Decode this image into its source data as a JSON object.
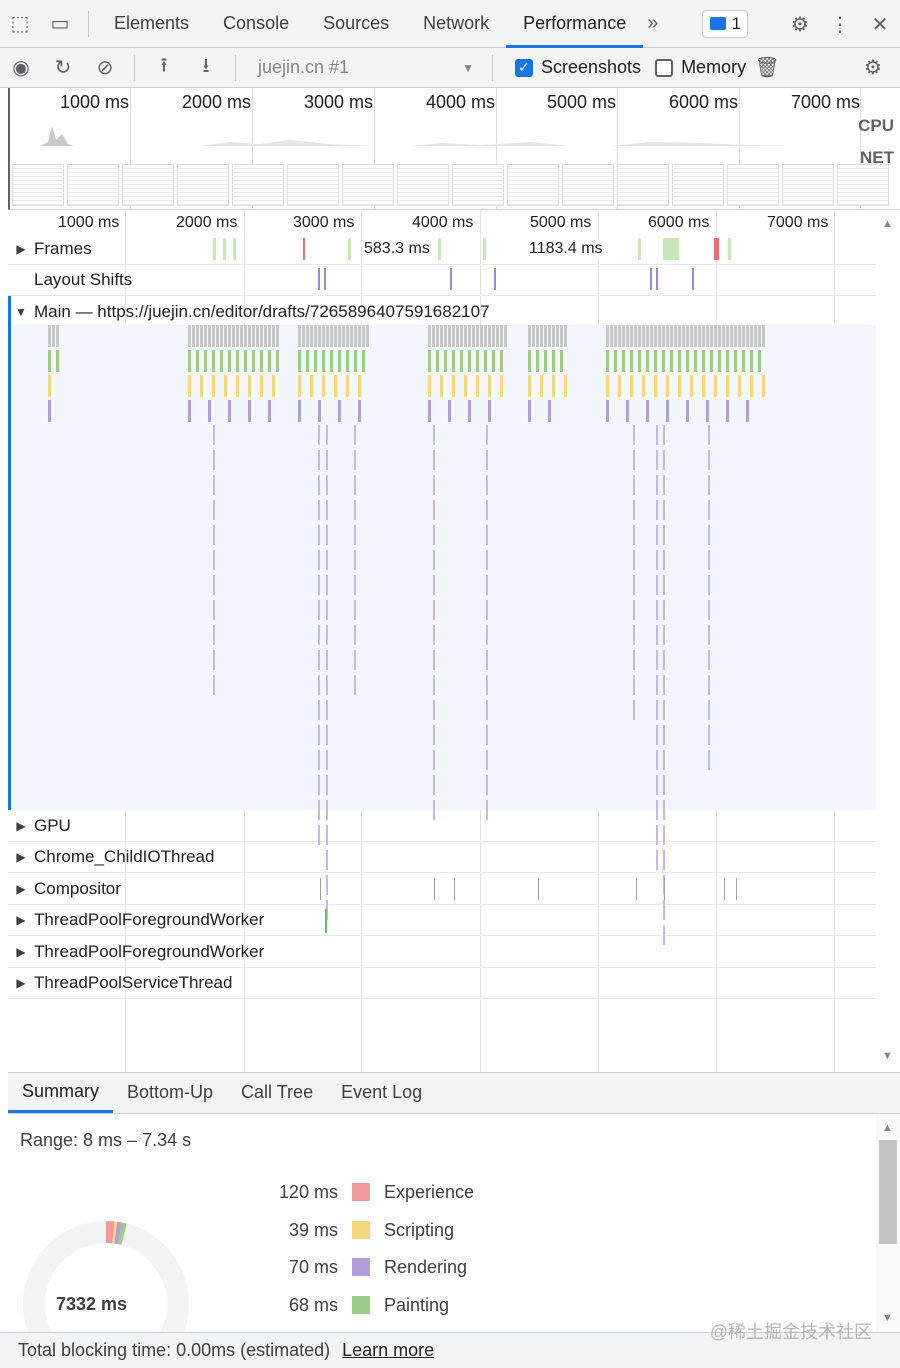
{
  "devtools": {
    "tabs": [
      {
        "label": "Elements"
      },
      {
        "label": "Console"
      },
      {
        "label": "Sources"
      },
      {
        "label": "Network"
      },
      {
        "label": "Performance"
      }
    ],
    "active_tab": "Performance",
    "issues_count": "1"
  },
  "toolbar": {
    "recording": "juejin.cn #1",
    "screenshots_label": "Screenshots",
    "screenshots_checked": true,
    "memory_label": "Memory",
    "memory_checked": false
  },
  "overview": {
    "ruler": [
      "1000 ms",
      "2000 ms",
      "3000 ms",
      "4000 ms",
      "5000 ms",
      "6000 ms",
      "7000 ms"
    ],
    "cpu_label": "CPU",
    "net_label": "NET"
  },
  "flame": {
    "ruler": [
      "1000 ms",
      "2000 ms",
      "3000 ms",
      "4000 ms",
      "5000 ms",
      "6000 ms",
      "7000 ms"
    ],
    "frames_label": "Frames",
    "frame_times": [
      "583.3 ms",
      "1183.4 ms"
    ],
    "layout_shifts_label": "Layout Shifts",
    "main_label": "Main — https://juejin.cn/editor/drafts/7265896407591682107",
    "threads": [
      {
        "label": "GPU"
      },
      {
        "label": "Chrome_ChildIOThread"
      },
      {
        "label": "Compositor"
      },
      {
        "label": "ThreadPoolForegroundWorker"
      },
      {
        "label": "ThreadPoolForegroundWorker"
      },
      {
        "label": "ThreadPoolServiceThread"
      }
    ]
  },
  "bottom_tabs": [
    "Summary",
    "Bottom-Up",
    "Call Tree",
    "Event Log"
  ],
  "summary": {
    "range": "Range: 8 ms – 7.34 s",
    "total": "7332 ms",
    "items": [
      {
        "value": "120 ms",
        "label": "Experience",
        "color": "#ef9a9a"
      },
      {
        "value": "39 ms",
        "label": "Scripting",
        "color": "#f5d67a"
      },
      {
        "value": "70 ms",
        "label": "Rendering",
        "color": "#b39ddb"
      },
      {
        "value": "68 ms",
        "label": "Painting",
        "color": "#9ccc8a"
      }
    ]
  },
  "footer": {
    "text": "Total blocking time: 0.00ms (estimated)",
    "link": "Learn more"
  },
  "watermark": "@稀土掘金技术社区"
}
